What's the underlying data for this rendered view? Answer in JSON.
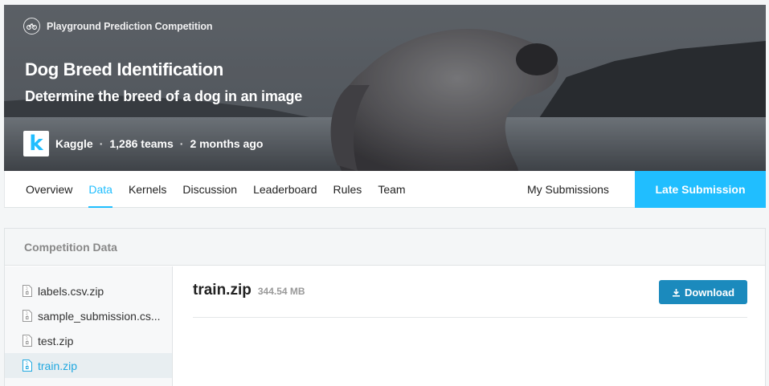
{
  "banner": {
    "badge_text": "Playground Prediction Competition",
    "badge_icon": "bicycle-icon",
    "title": "Dog Breed Identification",
    "subtitle": "Determine the breed of a dog in an image",
    "host_logo_letter": "k",
    "host_name": "Kaggle",
    "separator": "·",
    "teams": "1,286 teams",
    "age": "2 months ago"
  },
  "tabs": [
    {
      "label": "Overview"
    },
    {
      "label": "Data",
      "active": true
    },
    {
      "label": "Kernels"
    },
    {
      "label": "Discussion"
    },
    {
      "label": "Leaderboard"
    },
    {
      "label": "Rules"
    },
    {
      "label": "Team"
    }
  ],
  "my_submissions": "My Submissions",
  "late_submission": "Late Submission",
  "panel": {
    "heading": "Competition Data",
    "files": [
      {
        "label": "labels.csv.zip"
      },
      {
        "label": "sample_submission.cs..."
      },
      {
        "label": "test.zip"
      },
      {
        "label": "train.zip",
        "active": true
      }
    ],
    "selected_file": {
      "name": "train.zip",
      "size": "344.54 MB",
      "download_label": "Download"
    }
  },
  "colors": {
    "accent": "#20beff",
    "download": "#1b8abd"
  }
}
